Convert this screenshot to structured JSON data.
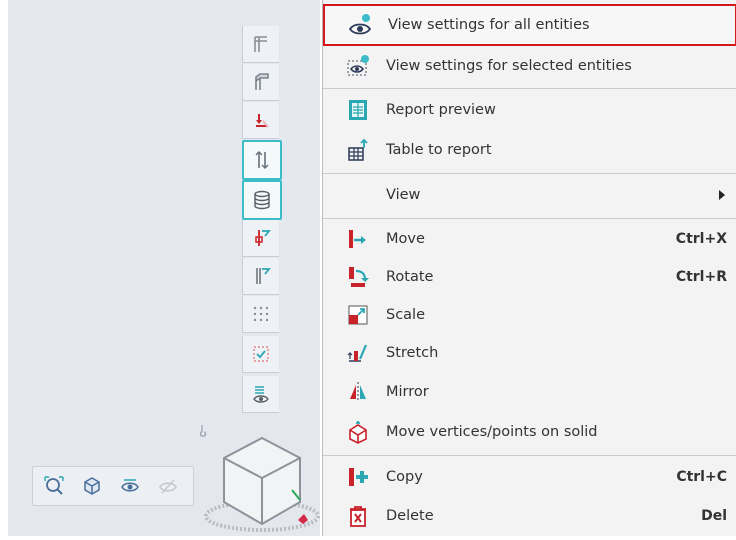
{
  "viewport": {
    "vertical_toolbar": [
      {
        "icon": "column-icon"
      },
      {
        "icon": "column-3d-icon"
      },
      {
        "icon": "load-icon"
      },
      {
        "icon": "dimension-arrows-icon",
        "active": true
      },
      {
        "icon": "database-icon",
        "active": true
      },
      {
        "icon": "support-icon"
      },
      {
        "icon": "beam-profile-icon"
      },
      {
        "icon": "grid-dots-icon"
      },
      {
        "icon": "check-selection-icon"
      },
      {
        "icon": "view-list-icon"
      }
    ],
    "nav_toolbar": [
      {
        "icon": "zoom-all-icon"
      },
      {
        "icon": "view-cube-icon"
      },
      {
        "icon": "visibility-icon"
      },
      {
        "icon": "hide-icon"
      }
    ]
  },
  "context_menu": {
    "items": [
      {
        "label": "View settings for all entities",
        "icon": "eye-settings-icon",
        "shortcut": "",
        "highlighted": true
      },
      {
        "label": "View settings for selected entities",
        "icon": "eye-selection-icon",
        "shortcut": ""
      },
      {
        "label": "Report preview",
        "icon": "report-preview-icon",
        "shortcut": ""
      },
      {
        "label": "Table to report",
        "icon": "table-to-report-icon",
        "shortcut": ""
      },
      {
        "label": "View",
        "icon": "",
        "shortcut": "",
        "submenu": true
      },
      {
        "label": "Move",
        "icon": "move-icon",
        "shortcut": "Ctrl+X"
      },
      {
        "label": "Rotate",
        "icon": "rotate-icon",
        "shortcut": "Ctrl+R"
      },
      {
        "label": "Scale",
        "icon": "scale-icon",
        "shortcut": ""
      },
      {
        "label": "Stretch",
        "icon": "stretch-icon",
        "shortcut": ""
      },
      {
        "label": "Mirror",
        "icon": "mirror-icon",
        "shortcut": ""
      },
      {
        "label": "Move vertices/points on solid",
        "icon": "move-vertices-icon",
        "shortcut": ""
      },
      {
        "label": "Copy",
        "icon": "copy-icon",
        "shortcut": "Ctrl+C"
      },
      {
        "label": "Delete",
        "icon": "delete-icon",
        "shortcut": "Del"
      }
    ]
  },
  "colors": {
    "accent": "#3bbcc8",
    "highlight_border": "#d3171d",
    "icon_red": "#c8222a",
    "icon_teal": "#2aa7b3",
    "menu_bg": "#f3f3f3",
    "viewport_bg": "#e4e8ee"
  }
}
